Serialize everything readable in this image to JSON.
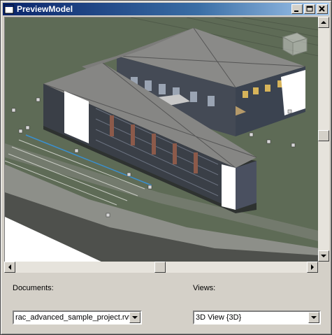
{
  "window": {
    "title": "PreviewModel"
  },
  "viewport": {
    "description_icon": "revit-3d-model-view",
    "viewcube_icon": "viewcube-icon"
  },
  "form": {
    "documents_label": "Documents:",
    "documents_value": "rac_advanced_sample_project.rvt",
    "views_label": "Views:",
    "views_value": "3D View {3D}"
  },
  "colors": {
    "titlebar": "#0a246a",
    "face": "#d4d0c8",
    "ground": "#5e6b56"
  }
}
